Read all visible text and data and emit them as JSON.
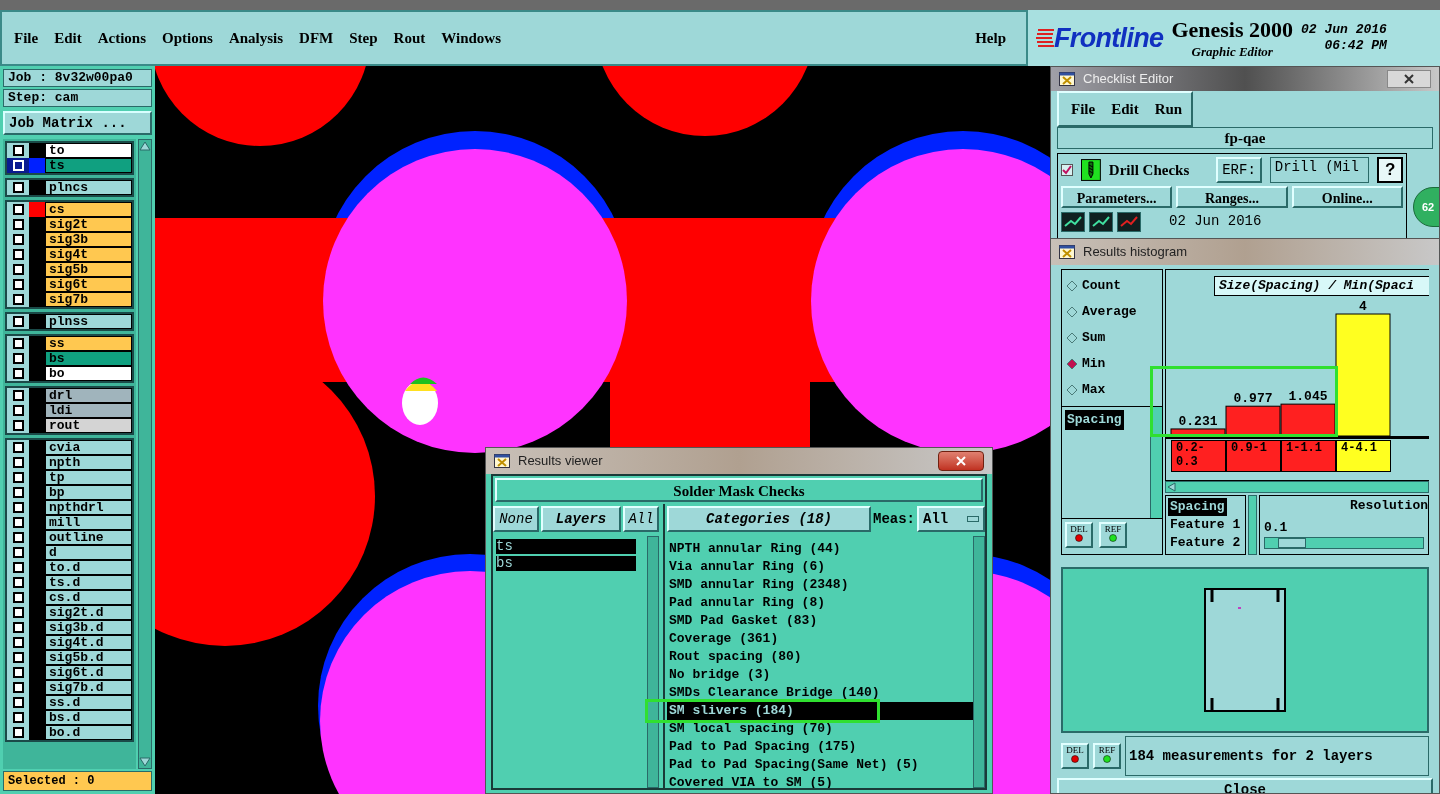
{
  "menu_bar": {
    "items": [
      "File",
      "Edit",
      "Actions",
      "Options",
      "Analysis",
      "DFM",
      "Step",
      "Rout",
      "Windows"
    ],
    "help": "Help"
  },
  "brand": {
    "logo": "Frontline",
    "product": "Genesis 2000",
    "subtitle": "Graphic Editor",
    "date": "02 Jun 2016",
    "time": "06:42 PM"
  },
  "job_panel": {
    "job": "Job : 8v32w00pa0",
    "step": "Step: cam",
    "matrix_button": "Job Matrix ...",
    "status": "Selected : 0",
    "layer_groups": [
      [
        {
          "name": "to",
          "color": "#ffffff",
          "selected": false
        },
        {
          "name": "ts",
          "color": "#10a080",
          "swatch": {
            "color": "#0020ff"
          },
          "selected": true
        }
      ],
      [
        {
          "name": "plncs",
          "color": "#9ed8d8",
          "selected": false
        }
      ],
      [
        {
          "name": "cs",
          "color": "#ffc850",
          "swatch": {
            "color": "#ff0000"
          },
          "selected": false
        },
        {
          "name": "sig2t",
          "color": "#ffc850",
          "selected": false
        },
        {
          "name": "sig3b",
          "color": "#ffc850",
          "selected": false
        },
        {
          "name": "sig4t",
          "color": "#ffc850",
          "selected": false
        },
        {
          "name": "sig5b",
          "color": "#ffc850",
          "selected": false
        },
        {
          "name": "sig6t",
          "color": "#ffc850",
          "selected": false
        },
        {
          "name": "sig7b",
          "color": "#ffc850",
          "selected": false
        }
      ],
      [
        {
          "name": "plnss",
          "color": "#9ed8d8",
          "selected": false
        }
      ],
      [
        {
          "name": "ss",
          "color": "#ffc850",
          "selected": false
        },
        {
          "name": "bs",
          "color": "#10a080",
          "selected": false
        },
        {
          "name": "bo",
          "color": "#ffffff",
          "selected": false
        }
      ],
      [
        {
          "name": "drl",
          "color": "#a0b4bc",
          "selected": false
        },
        {
          "name": "ldi",
          "color": "#a0b4bc",
          "selected": false
        },
        {
          "name": "rout",
          "color": "#d4d4d4",
          "selected": false
        }
      ],
      [
        {
          "name": "cvia",
          "color": "#9ed8d8",
          "selected": false
        },
        {
          "name": "npth",
          "color": "#9ed8d8",
          "selected": false
        },
        {
          "name": "tp",
          "color": "#9ed8d8",
          "selected": false
        },
        {
          "name": "bp",
          "color": "#9ed8d8",
          "selected": false
        },
        {
          "name": "npthdrl",
          "color": "#9ed8d8",
          "selected": false
        },
        {
          "name": "mill",
          "color": "#9ed8d8",
          "selected": false
        },
        {
          "name": "outline",
          "color": "#9ed8d8",
          "selected": false
        },
        {
          "name": "d",
          "color": "#9ed8d8",
          "selected": false
        },
        {
          "name": "to.d",
          "color": "#9ed8d8",
          "selected": false
        },
        {
          "name": "ts.d",
          "color": "#9ed8d8",
          "selected": false
        },
        {
          "name": "cs.d",
          "color": "#9ed8d8",
          "selected": false
        },
        {
          "name": "sig2t.d",
          "color": "#9ed8d8",
          "selected": false
        },
        {
          "name": "sig3b.d",
          "color": "#9ed8d8",
          "selected": false
        },
        {
          "name": "sig4t.d",
          "color": "#9ed8d8",
          "selected": false
        },
        {
          "name": "sig5b.d",
          "color": "#9ed8d8",
          "selected": false
        },
        {
          "name": "sig6t.d",
          "color": "#9ed8d8",
          "selected": false
        },
        {
          "name": "sig7b.d",
          "color": "#9ed8d8",
          "selected": false
        },
        {
          "name": "ss.d",
          "color": "#9ed8d8",
          "selected": false
        },
        {
          "name": "bs.d",
          "color": "#9ed8d8",
          "selected": false
        },
        {
          "name": "bo.d",
          "color": "#9ed8d8",
          "selected": false
        }
      ]
    ]
  },
  "checklist_editor": {
    "title": "Checklist Editor",
    "menu": [
      "File",
      "Edit",
      "Run"
    ],
    "checklist": "fp-qae",
    "check": {
      "checked": true,
      "name": "Drill Checks",
      "erf_button": "ERF:",
      "erf_value": "Drill (Mil",
      "help_button": "?"
    },
    "buttons": [
      "Parameters...",
      "Ranges...",
      "Online..."
    ],
    "date": "02 Jun 2016",
    "badge": "62"
  },
  "results_histogram": {
    "title": "Results histogram",
    "modes": [
      {
        "label": "Count",
        "selected": false
      },
      {
        "label": "Average",
        "selected": false
      },
      {
        "label": "Sum",
        "selected": false
      },
      {
        "label": "Min",
        "selected": true
      },
      {
        "label": "Max",
        "selected": false
      }
    ],
    "measures": [
      {
        "label": "Spacing",
        "selected": true
      }
    ],
    "del_button": "DEL",
    "ref_button": "REF",
    "chart_data": {
      "type": "bar",
      "title": "Size(Spacing) / Min(Spaci",
      "categories": [
        "0.2-0.3",
        "0.9-1",
        "1-1.1",
        "4-4.1"
      ],
      "series": [
        {
          "color": "#ff2020",
          "values": [
            0.231,
            0.977,
            1.045,
            null
          ]
        },
        {
          "color": "#ffff20",
          "values": [
            null,
            null,
            null,
            4
          ]
        }
      ],
      "data_labels": true
    },
    "fields": [
      {
        "label": "Spacing",
        "selected": true
      },
      {
        "label": "Feature 1",
        "selected": false
      },
      {
        "label": "Feature 2",
        "selected": false
      }
    ],
    "resolution_label": "Resolution",
    "resolution_value": "0.1",
    "resolution": {
      "level": 0.1
    },
    "preview_del_button": "DEL",
    "preview_ref_button": "REF",
    "status": "184 measurements for 2 layers",
    "close_button": "Close"
  },
  "results_viewer": {
    "title": "Results viewer",
    "header": "Solder Mask Checks",
    "none_button": "None",
    "layers_button": "Layers",
    "all_button": "All",
    "categories_button": "Categories (18)",
    "meas_label": "Meas:",
    "meas_value": "All",
    "layers": [
      {
        "label": "ts",
        "selected": true
      },
      {
        "label": "bs",
        "selected": true
      }
    ],
    "categories": [
      {
        "label": "NPTH annular Ring (44)",
        "selected": false
      },
      {
        "label": "Via annular Ring (6)",
        "selected": false
      },
      {
        "label": "SMD annular Ring (2348)",
        "selected": false
      },
      {
        "label": "Pad annular Ring (8)",
        "selected": false
      },
      {
        "label": "SMD Pad Gasket (83)",
        "selected": false
      },
      {
        "label": "Coverage (361)",
        "selected": false
      },
      {
        "label": "Rout spacing (80)",
        "selected": false
      },
      {
        "label": "No bridge (3)",
        "selected": false
      },
      {
        "label": "SMDs Clearance Bridge (140)",
        "selected": false
      },
      {
        "label": "SM slivers (184)",
        "selected": true
      },
      {
        "label": "SM local spacing (70)",
        "selected": false
      },
      {
        "label": "Pad to Pad Spacing (175)",
        "selected": false
      },
      {
        "label": "Pad to Pad Spacing(Same Net) (5)",
        "selected": false
      },
      {
        "label": "Covered VIA to SM (5)",
        "selected": false
      }
    ]
  }
}
